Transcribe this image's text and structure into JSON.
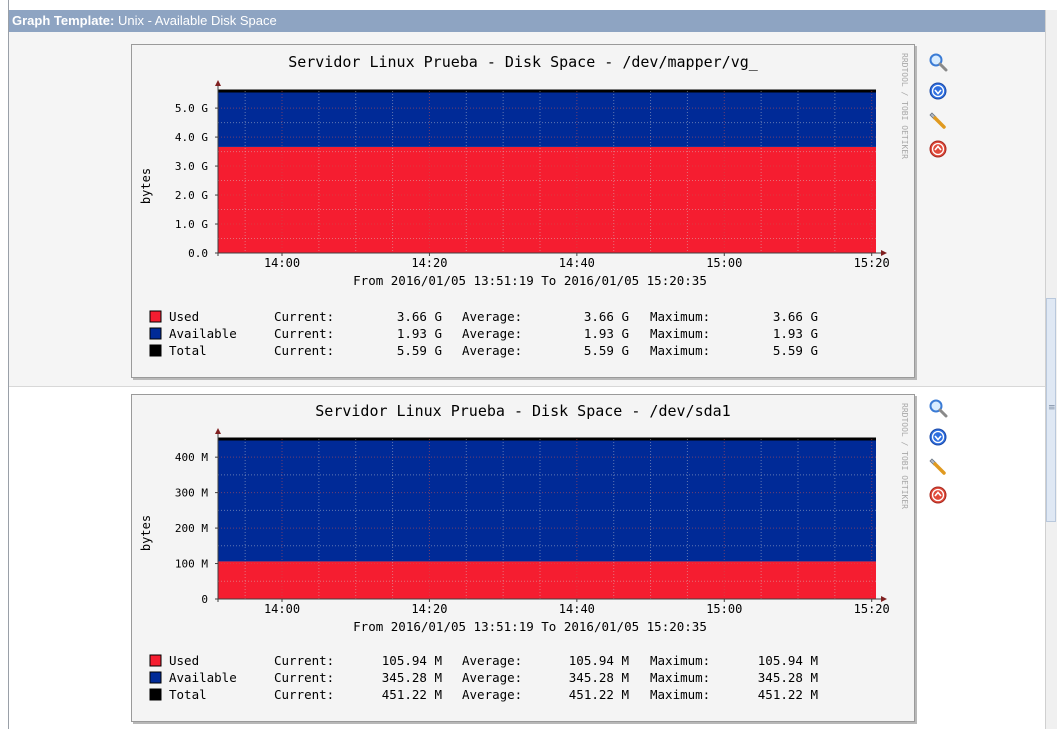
{
  "header": {
    "label": "Graph Template:",
    "value": "Unix - Available Disk Space"
  },
  "watermark": "RRDTOOL / TOBI OETIKER",
  "colors": {
    "used": "#f51d30",
    "available": "#002a97",
    "total": "#000000",
    "header_bg": "#8ea4c2"
  },
  "icons": [
    "zoom-icon",
    "download-icon",
    "properties-icon",
    "move-up-icon"
  ],
  "graphs": [
    {
      "title": "Servidor Linux Prueba - Disk Space - /dev/mapper/vg_",
      "ylabel": "bytes",
      "yticks": [
        "0.0",
        "1.0 G",
        "2.0 G",
        "3.0 G",
        "4.0 G",
        "5.0 G"
      ],
      "xticks": [
        "14:00",
        "14:20",
        "14:40",
        "15:00",
        "15:20"
      ],
      "from_to": "From 2016/01/05 13:51:19 To 2016/01/05 15:20:35",
      "legend": [
        {
          "name": "Used",
          "cur_label": "Current:",
          "cur": "3.66 G",
          "avg_label": "Average:",
          "avg": "3.66 G",
          "max_label": "Maximum:",
          "max": "3.66 G"
        },
        {
          "name": "Available",
          "cur_label": "Current:",
          "cur": "1.93 G",
          "avg_label": "Average:",
          "avg": "1.93 G",
          "max_label": "Maximum:",
          "max": "1.93 G"
        },
        {
          "name": "Total",
          "cur_label": "Current:",
          "cur": "5.59 G",
          "avg_label": "Average:",
          "avg": "5.59 G",
          "max_label": "Maximum:",
          "max": "5.59 G"
        }
      ]
    },
    {
      "title": "Servidor Linux Prueba - Disk Space - /dev/sda1",
      "ylabel": "bytes",
      "yticks": [
        "0",
        "100 M",
        "200 M",
        "300 M",
        "400 M"
      ],
      "xticks": [
        "14:00",
        "14:20",
        "14:40",
        "15:00",
        "15:20"
      ],
      "from_to": "From 2016/01/05 13:51:19 To 2016/01/05 15:20:35",
      "legend": [
        {
          "name": "Used",
          "cur_label": "Current:",
          "cur": "105.94 M",
          "avg_label": "Average:",
          "avg": "105.94 M",
          "max_label": "Maximum:",
          "max": "105.94 M"
        },
        {
          "name": "Available",
          "cur_label": "Current:",
          "cur": "345.28 M",
          "avg_label": "Average:",
          "avg": "345.28 M",
          "max_label": "Maximum:",
          "max": "345.28 M"
        },
        {
          "name": "Total",
          "cur_label": "Current:",
          "cur": "451.22 M",
          "avg_label": "Average:",
          "avg": "451.22 M",
          "max_label": "Maximum:",
          "max": "451.22 M"
        }
      ]
    }
  ],
  "chart_data": [
    {
      "type": "area",
      "title": "Servidor Linux Prueba - Disk Space - /dev/mapper/vg_",
      "xlabel": "",
      "ylabel": "bytes",
      "unit": "G",
      "x_range": [
        "13:51:19",
        "15:20:35"
      ],
      "ylim": [
        0,
        5.59
      ],
      "stacked": true,
      "grid": true,
      "series": [
        {
          "name": "Used",
          "values": [
            3.66,
            3.66
          ]
        },
        {
          "name": "Available",
          "values": [
            1.93,
            1.93
          ]
        }
      ],
      "total_line": 5.59
    },
    {
      "type": "area",
      "title": "Servidor Linux Prueba - Disk Space - /dev/sda1",
      "xlabel": "",
      "ylabel": "bytes",
      "unit": "M",
      "x_range": [
        "13:51:19",
        "15:20:35"
      ],
      "ylim": [
        0,
        451.22
      ],
      "stacked": true,
      "grid": true,
      "series": [
        {
          "name": "Used",
          "values": [
            105.94,
            105.94
          ]
        },
        {
          "name": "Available",
          "values": [
            345.28,
            345.28
          ]
        }
      ],
      "total_line": 451.22
    }
  ]
}
